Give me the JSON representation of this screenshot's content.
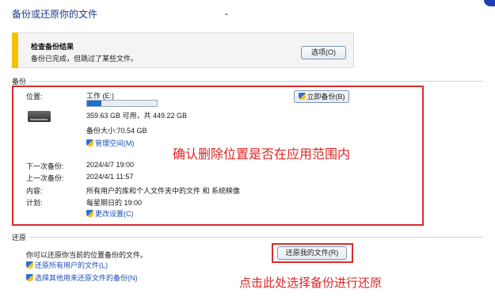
{
  "window": {
    "title": "备份或还原你的文件",
    "marker": "-"
  },
  "alert": {
    "title": "检查备份结果",
    "text": "备份已完成，但跳过了某些文件。",
    "button": "选项(O)"
  },
  "backup": {
    "section_label": "备份",
    "location_label": "位置:",
    "drive_name": "工作 (E:)",
    "progress_fraction": 0.2,
    "space_text": "359.63 GB 可用，共 449.22 GB",
    "size_text": "备份大小:70.54 GB",
    "manage_space": "管理空间(M)",
    "backup_now": "立即备份(B)",
    "next_label": "下一次备份:",
    "next_value": "2024/4/7 19:00",
    "last_label": "上一次备份:",
    "last_value": "2024/4/1 11:57",
    "content_label": "内容:",
    "content_value": "所有用户的库和个人文件夹中的文件 和 系统映像",
    "schedule_label": "计划:",
    "schedule_value": "每星期日的 19:00",
    "change_settings": "更改设置(C)"
  },
  "restore": {
    "section_label": "还原",
    "text": "你可以还原你当前的位置备份的文件。",
    "restore_mine": "还原我的文件(R)",
    "restore_all": "还原所有用户的文件(L)",
    "select_other": "选择其他用来还原文件的备份(N)"
  },
  "annotations": {
    "note1": "确认删除位置是否在应用范围内",
    "note2": "点击此处选择备份进行还原"
  },
  "colors": {
    "accent": "#1f6fd1",
    "annotation": "#e02424",
    "warning": "#f2c200"
  }
}
